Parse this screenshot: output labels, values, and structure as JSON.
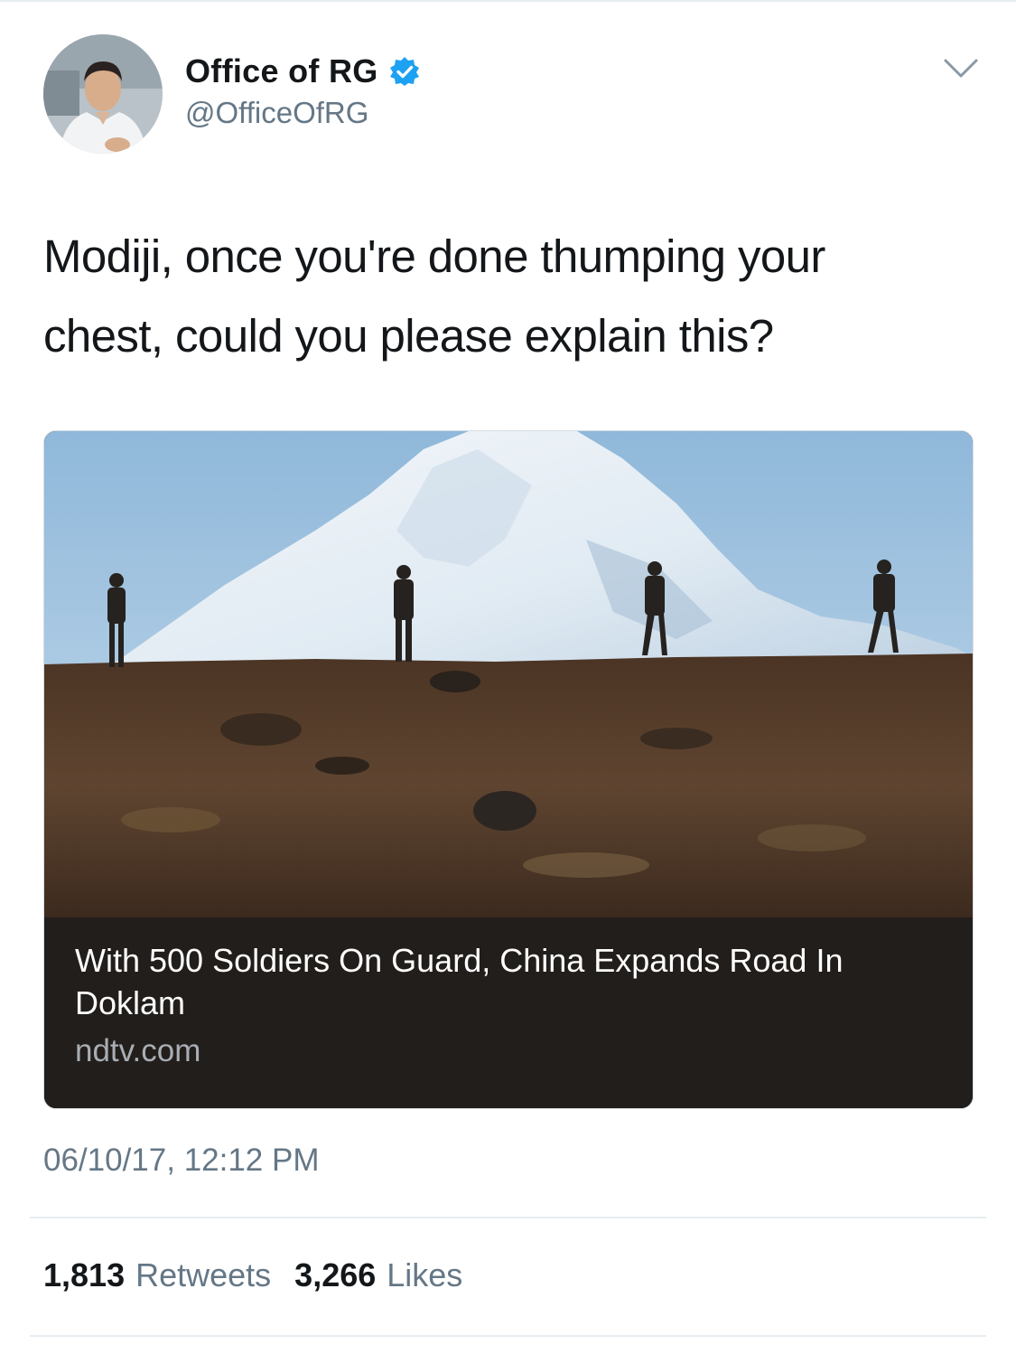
{
  "tweet": {
    "author": {
      "display_name": "Office of RG",
      "handle": "@OfficeOfRG",
      "verified": true,
      "avatar_icon": "profile-photo-avatar"
    },
    "menu_icon": "chevron-down-icon",
    "text_lines": [
      "Modiji, once you're done thumping your",
      "chest, could you please explain this?"
    ],
    "card": {
      "image_icon": "soldiers-on-mountain-ridge-photo",
      "title": "With 500 Soldiers On Guard, China Expands Road In Doklam",
      "domain": "ndtv.com"
    },
    "timestamp": "06/10/17, 12:12 PM",
    "stats": {
      "retweets_count": "1,813",
      "retweets_label": "Retweets",
      "likes_count": "3,266",
      "likes_label": "Likes"
    }
  },
  "colors": {
    "verified_blue": "#1da1f2",
    "secondary_text": "#657786",
    "card_background": "#221e1b",
    "divider": "#e6ecf0"
  }
}
